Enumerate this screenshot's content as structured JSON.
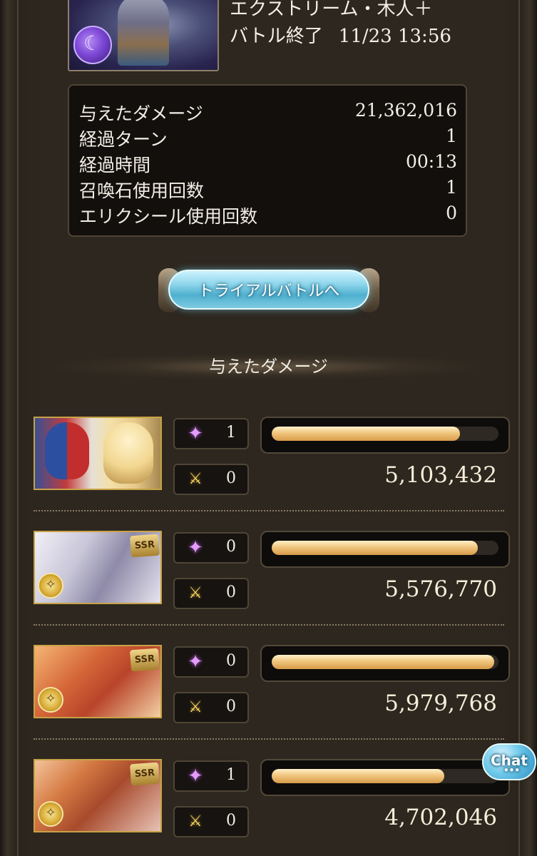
{
  "quest": {
    "title": "エクストリーム・木人＋",
    "status_label": "バトル終了",
    "datetime": "11/23 13:56"
  },
  "stats": [
    {
      "label": "与えたダメージ",
      "value": "21,362,016"
    },
    {
      "label": "経過ターン",
      "value": "1"
    },
    {
      "label": "経過時間",
      "value": "00:13"
    },
    {
      "label": "召喚石使用回数",
      "value": "1"
    },
    {
      "label": "エリクシール使用回数",
      "value": "0"
    }
  ],
  "trial_button_label": "トライアルバトルへ",
  "section_title": "与えたダメージ",
  "characters": [
    {
      "summons": "1",
      "swords": "0",
      "damage": "5,103,432",
      "bar_fraction": 0.83,
      "rarity": ""
    },
    {
      "summons": "0",
      "swords": "0",
      "damage": "5,576,770",
      "bar_fraction": 0.91,
      "rarity": "SSR"
    },
    {
      "summons": "0",
      "swords": "0",
      "damage": "5,979,768",
      "bar_fraction": 0.98,
      "rarity": "SSR"
    },
    {
      "summons": "1",
      "swords": "0",
      "damage": "4,702,046",
      "bar_fraction": 0.76,
      "rarity": "SSR"
    }
  ],
  "chat_label": "Chat",
  "icons": {
    "summon": "summon-sparkle-icon",
    "sword": "crossed-swords-icon",
    "element": "element-light-icon"
  },
  "colors": {
    "bar_fill": "#f0c67e",
    "button_blue": "#8fd6ec",
    "background": "#2d271f"
  }
}
